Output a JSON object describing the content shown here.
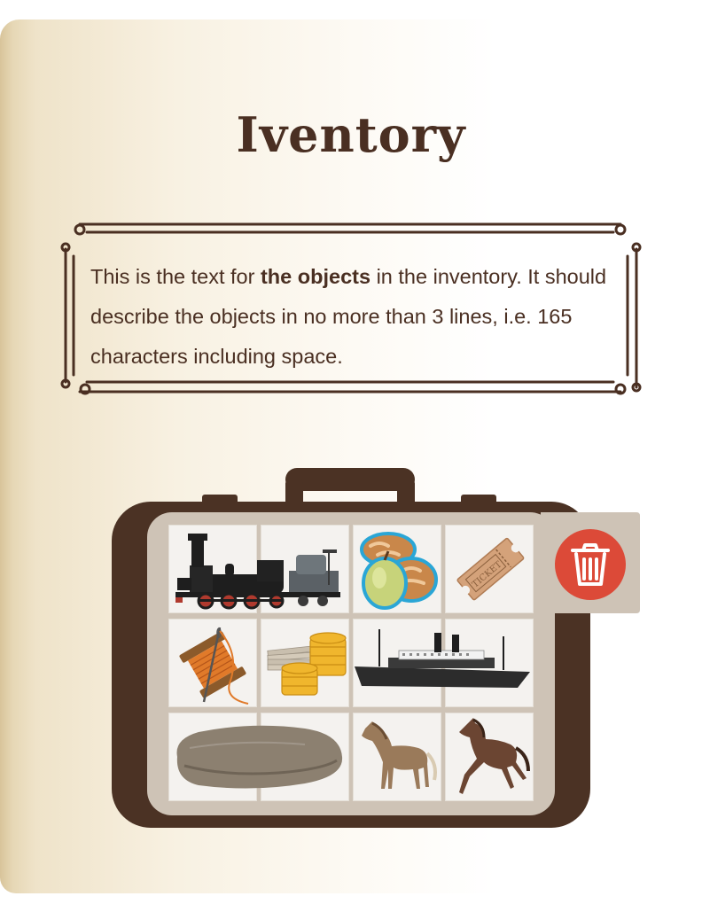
{
  "inventory": {
    "title": "Iventory",
    "description": {
      "before": "This is the text for ",
      "bold": "the objects",
      "after": " in the inventory. It should describe the objects in no more than 3 lines, i.e. 165 characters including space."
    },
    "items": [
      {
        "name": "locomotive"
      },
      {
        "name": "bread-and-apple"
      },
      {
        "name": "ticket",
        "label": "TICKET"
      },
      {
        "name": "thread-spool-and-needle"
      },
      {
        "name": "money-stack-and-coins"
      },
      {
        "name": "steamship"
      },
      {
        "name": "cloth-sack"
      },
      {
        "name": "horse-light-brown"
      },
      {
        "name": "horse-dark-brown"
      }
    ],
    "trash_icon": "trash-icon"
  },
  "colors": {
    "title": "#4a2f22",
    "suitcase": "#4b3224",
    "tray": "#cec3b6",
    "trash": "#dc4a38"
  }
}
